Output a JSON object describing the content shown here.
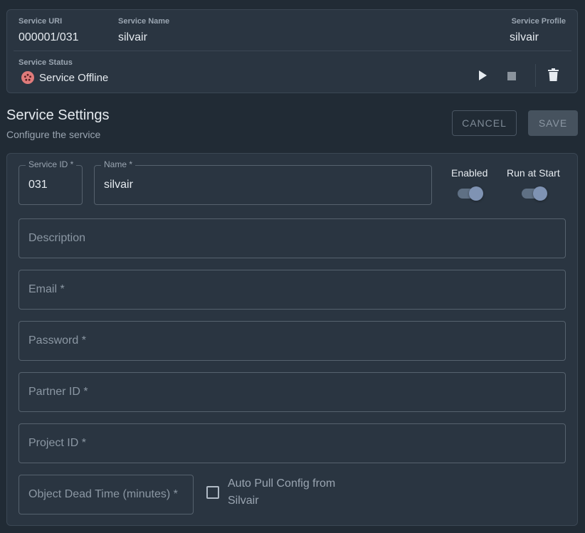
{
  "service": {
    "uri_label": "Service URI",
    "uri": "000001/031",
    "name_label": "Service Name",
    "name": "silvair",
    "profile_label": "Service Profile",
    "profile": "silvair",
    "status_label": "Service Status",
    "status": "Service Offline"
  },
  "settings": {
    "title": "Service Settings",
    "subtitle": "Configure the service",
    "cancel_label": "CANCEL",
    "save_label": "SAVE"
  },
  "form": {
    "service_id_label": "Service ID *",
    "service_id": "031",
    "name_label": "Name *",
    "name": "silvair",
    "enabled_label": "Enabled",
    "enabled": true,
    "run_at_start_label": "Run at Start",
    "run_at_start": true,
    "description_placeholder": "Description",
    "email_placeholder": "Email *",
    "password_placeholder": "Password *",
    "partner_id_placeholder": "Partner ID *",
    "project_id_placeholder": "Project ID *",
    "dead_time_placeholder": "Object Dead Time (minutes) *",
    "auto_pull_label": "Auto Pull Config from Silvair",
    "auto_pull": false
  },
  "colors": {
    "background": "#212b35",
    "card": "#2a3541",
    "status_offline": "#e07b7b",
    "toggle_thumb": "#7f93b3"
  },
  "icons": {
    "status": "offline-status-icon",
    "start": "play-icon",
    "stop": "stop-icon",
    "delete": "trash-icon"
  }
}
